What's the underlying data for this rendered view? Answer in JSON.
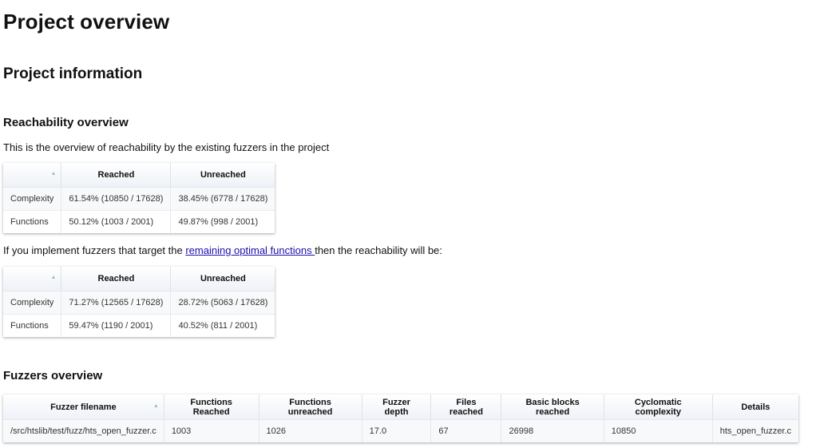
{
  "page_title": "Project overview",
  "section_title": "Project information",
  "reachability": {
    "heading": "Reachability overview",
    "intro": "This is the overview of reachability by the existing fuzzers in the project",
    "table_current": {
      "headers": [
        "",
        "Reached",
        "Unreached"
      ],
      "rows": [
        {
          "label": "Complexity",
          "reached": "61.54% (10850 / 17628)",
          "unreached": "38.45% (6778 / 17628)"
        },
        {
          "label": "Functions",
          "reached": "50.12% (1003 / 2001)",
          "unreached": "49.87% (998 / 2001)"
        }
      ]
    },
    "optimal_sentence": {
      "before": "If you implement fuzzers that target the ",
      "link": "remaining optimal functions ",
      "after": "then the reachability will be:"
    },
    "table_optimal": {
      "headers": [
        "",
        "Reached",
        "Unreached"
      ],
      "rows": [
        {
          "label": "Complexity",
          "reached": "71.27% (12565 / 17628)",
          "unreached": "28.72% (5063 / 17628)"
        },
        {
          "label": "Functions",
          "reached": "59.47% (1190 / 2001)",
          "unreached": "40.52% (811 / 2001)"
        }
      ]
    }
  },
  "fuzzers": {
    "heading": "Fuzzers overview",
    "headers": [
      "Fuzzer filename",
      "Functions Reached",
      "Functions unreached",
      "Fuzzer depth",
      "Files reached",
      "Basic blocks reached",
      "Cyclomatic complexity",
      "Details"
    ],
    "rows": [
      [
        "/src/htslib/test/fuzz/hts_open_fuzzer.c",
        "1003",
        "1026",
        "17.0",
        "67",
        "26998",
        "10850",
        "hts_open_fuzzer.c"
      ]
    ]
  },
  "colors": {
    "link": "#1a0dab",
    "header_gradient_end": "#eef2f7",
    "sort_icon": "#aab6c8"
  },
  "icons": [
    "sort-ascending-icon"
  ]
}
